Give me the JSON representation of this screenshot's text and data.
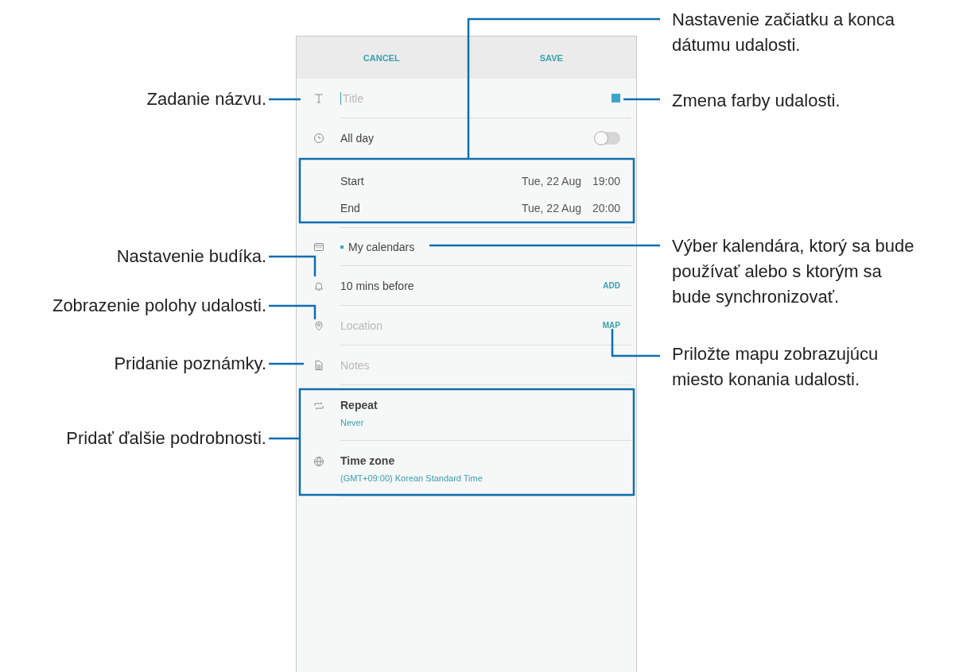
{
  "phone": {
    "header": [
      {
        "label": "CANCEL"
      },
      {
        "label": "SAVE"
      }
    ],
    "rows": [
      {
        "kind": "title",
        "placeholder": "Title",
        "color": "#3aa6cc"
      },
      {
        "kind": "toggle",
        "label": "All day",
        "on": false
      },
      {
        "kind": "datetime",
        "label": "Start",
        "date": "Tue, 22 Aug",
        "time": "19:00"
      },
      {
        "kind": "datetime",
        "label": "End",
        "date": "Tue, 22 Aug",
        "time": "20:00"
      },
      {
        "kind": "calendar",
        "label": "My calendars",
        "color": "#3aa6cc"
      },
      {
        "kind": "alarm",
        "label": "10 mins before",
        "action": "ADD"
      },
      {
        "kind": "location",
        "placeholder": "Location",
        "action": "MAP"
      },
      {
        "kind": "notes",
        "placeholder": "Notes"
      },
      {
        "kind": "repeat",
        "label": "Repeat",
        "value": "Never"
      },
      {
        "kind": "timezone",
        "label": "Time zone",
        "value": "(GMT+09:00) Korean Standard Time"
      }
    ]
  },
  "callouts": [
    {
      "text": "Zadanie názvu."
    },
    {
      "text": "Nastavenie budíka."
    },
    {
      "text": "Zobrazenie polohy udalosti."
    },
    {
      "text": "Pridanie poznámky."
    },
    {
      "text": "Pridať ďalšie podrobnosti."
    },
    {
      "text": "Nastavenie začiatku a konca\ndátumu udalosti."
    },
    {
      "text": "Zmena farby udalosti."
    },
    {
      "text": "Výber kalendára, ktorý sa bude\npoužívať alebo s ktorým sa\nbude synchronizovať."
    },
    {
      "text": "Priložte mapu zobrazujúcu\nmiesto konania udalosti."
    }
  ]
}
